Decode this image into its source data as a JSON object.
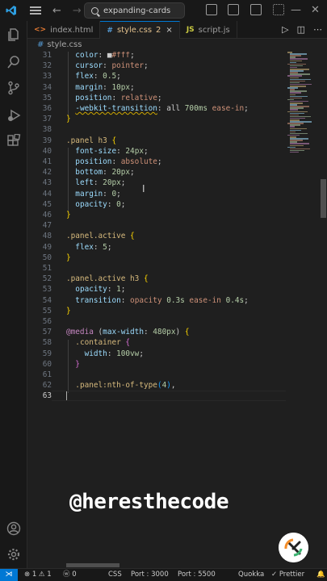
{
  "titlebar": {
    "search_text": "expanding-cards"
  },
  "tabs": [
    {
      "label": "index.html",
      "icon": "<>",
      "icon_color": "#e37933",
      "active": false,
      "modified": ""
    },
    {
      "label": "style.css",
      "icon": "#",
      "icon_color": "#569cd6",
      "active": true,
      "modified": "2"
    },
    {
      "label": "script.js",
      "icon": "JS",
      "icon_color": "#cbcb41",
      "active": false,
      "modified": ""
    }
  ],
  "breadcrumb": {
    "file": "style.css"
  },
  "editor": {
    "lines": [
      {
        "n": "31",
        "tokens": [
          [
            "  ",
            "t-pun"
          ],
          [
            "color",
            "t-prop"
          ],
          [
            ": ",
            "t-pun"
          ],
          [
            "■",
            "t-pun"
          ],
          [
            "#fff",
            "t-str"
          ],
          [
            ";",
            "t-pun"
          ]
        ]
      },
      {
        "n": "32",
        "tokens": [
          [
            "  ",
            "t-pun"
          ],
          [
            "cursor",
            "t-prop"
          ],
          [
            ": ",
            "t-pun"
          ],
          [
            "pointer",
            "t-str"
          ],
          [
            ";",
            "t-pun"
          ]
        ]
      },
      {
        "n": "33",
        "tokens": [
          [
            "  ",
            "t-pun"
          ],
          [
            "flex",
            "t-prop"
          ],
          [
            ": ",
            "t-pun"
          ],
          [
            "0.5",
            "t-num"
          ],
          [
            ";",
            "t-pun"
          ]
        ]
      },
      {
        "n": "34",
        "tokens": [
          [
            "  ",
            "t-pun"
          ],
          [
            "margin",
            "t-prop"
          ],
          [
            ": ",
            "t-pun"
          ],
          [
            "10px",
            "t-num"
          ],
          [
            ";",
            "t-pun"
          ]
        ]
      },
      {
        "n": "35",
        "tokens": [
          [
            "  ",
            "t-pun"
          ],
          [
            "position",
            "t-prop"
          ],
          [
            ": ",
            "t-pun"
          ],
          [
            "relative",
            "t-str"
          ],
          [
            ";",
            "t-pun"
          ]
        ]
      },
      {
        "n": "36",
        "tokens": [
          [
            "  ",
            "t-pun"
          ],
          [
            "-webkit-transition",
            "t-prop t-err"
          ],
          [
            ": all ",
            "t-pun"
          ],
          [
            "700ms",
            "t-num"
          ],
          [
            " ease-in",
            "t-str"
          ],
          [
            ";",
            "t-pun"
          ]
        ]
      },
      {
        "n": "37",
        "tokens": [
          [
            "}",
            "t-br1"
          ]
        ]
      },
      {
        "n": "38",
        "tokens": []
      },
      {
        "n": "39",
        "tokens": [
          [
            ".panel h3 ",
            "t-sel"
          ],
          [
            "{",
            "t-br1"
          ]
        ]
      },
      {
        "n": "40",
        "tokens": [
          [
            "  ",
            "t-pun"
          ],
          [
            "font-size",
            "t-prop"
          ],
          [
            ": ",
            "t-pun"
          ],
          [
            "24px",
            "t-num"
          ],
          [
            ";",
            "t-pun"
          ]
        ]
      },
      {
        "n": "41",
        "tokens": [
          [
            "  ",
            "t-pun"
          ],
          [
            "position",
            "t-prop"
          ],
          [
            ": ",
            "t-pun"
          ],
          [
            "absolute",
            "t-str"
          ],
          [
            ";",
            "t-pun"
          ]
        ]
      },
      {
        "n": "42",
        "tokens": [
          [
            "  ",
            "t-pun"
          ],
          [
            "bottom",
            "t-prop"
          ],
          [
            ": ",
            "t-pun"
          ],
          [
            "20px",
            "t-num"
          ],
          [
            ";",
            "t-pun"
          ]
        ]
      },
      {
        "n": "43",
        "tokens": [
          [
            "  ",
            "t-pun"
          ],
          [
            "left",
            "t-prop"
          ],
          [
            ": ",
            "t-pun"
          ],
          [
            "20px",
            "t-num"
          ],
          [
            ";",
            "t-pun"
          ]
        ]
      },
      {
        "n": "44",
        "tokens": [
          [
            "  ",
            "t-pun"
          ],
          [
            "margin",
            "t-prop"
          ],
          [
            ": ",
            "t-pun"
          ],
          [
            "0",
            "t-num"
          ],
          [
            ";",
            "t-pun"
          ]
        ]
      },
      {
        "n": "45",
        "tokens": [
          [
            "  ",
            "t-pun"
          ],
          [
            "opacity",
            "t-prop"
          ],
          [
            ": ",
            "t-pun"
          ],
          [
            "0",
            "t-num"
          ],
          [
            ";",
            "t-pun"
          ]
        ]
      },
      {
        "n": "46",
        "tokens": [
          [
            "}",
            "t-br1"
          ]
        ]
      },
      {
        "n": "47",
        "tokens": []
      },
      {
        "n": "48",
        "tokens": [
          [
            ".panel.active ",
            "t-sel"
          ],
          [
            "{",
            "t-br1"
          ]
        ]
      },
      {
        "n": "49",
        "tokens": [
          [
            "  ",
            "t-pun"
          ],
          [
            "flex",
            "t-prop"
          ],
          [
            ": ",
            "t-pun"
          ],
          [
            "5",
            "t-num"
          ],
          [
            ";",
            "t-pun"
          ]
        ]
      },
      {
        "n": "50",
        "tokens": [
          [
            "}",
            "t-br1"
          ]
        ]
      },
      {
        "n": "51",
        "tokens": []
      },
      {
        "n": "52",
        "tokens": [
          [
            ".panel.active h3 ",
            "t-sel"
          ],
          [
            "{",
            "t-br1"
          ]
        ]
      },
      {
        "n": "53",
        "tokens": [
          [
            "  ",
            "t-pun"
          ],
          [
            "opacity",
            "t-prop"
          ],
          [
            ": ",
            "t-pun"
          ],
          [
            "1",
            "t-num"
          ],
          [
            ";",
            "t-pun"
          ]
        ]
      },
      {
        "n": "54",
        "tokens": [
          [
            "  ",
            "t-pun"
          ],
          [
            "transition",
            "t-prop"
          ],
          [
            ": ",
            "t-pun"
          ],
          [
            "opacity ",
            "t-str"
          ],
          [
            "0.3s",
            "t-num"
          ],
          [
            " ease-in ",
            "t-str"
          ],
          [
            "0.4s",
            "t-num"
          ],
          [
            ";",
            "t-pun"
          ]
        ]
      },
      {
        "n": "55",
        "tokens": [
          [
            "}",
            "t-br1"
          ]
        ]
      },
      {
        "n": "56",
        "tokens": []
      },
      {
        "n": "57",
        "tokens": [
          [
            "@media ",
            "t-kw"
          ],
          [
            "(",
            "t-pun"
          ],
          [
            "max-width",
            "t-prop"
          ],
          [
            ": ",
            "t-pun"
          ],
          [
            "480px",
            "t-num"
          ],
          [
            ") ",
            "t-pun"
          ],
          [
            "{",
            "t-br1"
          ]
        ]
      },
      {
        "n": "58",
        "tokens": [
          [
            "  ",
            "t-pun"
          ],
          [
            ".container ",
            "t-sel"
          ],
          [
            "{",
            "t-br2"
          ]
        ]
      },
      {
        "n": "59",
        "tokens": [
          [
            "    ",
            "t-pun"
          ],
          [
            "width",
            "t-prop"
          ],
          [
            ": ",
            "t-pun"
          ],
          [
            "100vw",
            "t-num"
          ],
          [
            ";",
            "t-pun"
          ]
        ]
      },
      {
        "n": "60",
        "tokens": [
          [
            "  ",
            "t-pun"
          ],
          [
            "}",
            "t-br2"
          ]
        ]
      },
      {
        "n": "61",
        "tokens": []
      },
      {
        "n": "62",
        "tokens": [
          [
            "  ",
            "t-pun"
          ],
          [
            ".panel:nth-of-type",
            "t-sel"
          ],
          [
            "(",
            "t-br3"
          ],
          [
            "4",
            "t-num"
          ],
          [
            ")",
            "t-br3"
          ],
          [
            ",",
            "t-pun"
          ]
        ]
      },
      {
        "n": "63",
        "tokens": [],
        "current": true
      }
    ]
  },
  "watermark": "@heresthecode",
  "statusbar": {
    "problems": "⊗ 1 ⚠ 1",
    "ports_count": "ⓦ 0",
    "css": "CSS",
    "port1": "Port : 3000",
    "port2": "Port : 5500",
    "quokka": "Quokka",
    "prettier": "✓ Prettier"
  }
}
